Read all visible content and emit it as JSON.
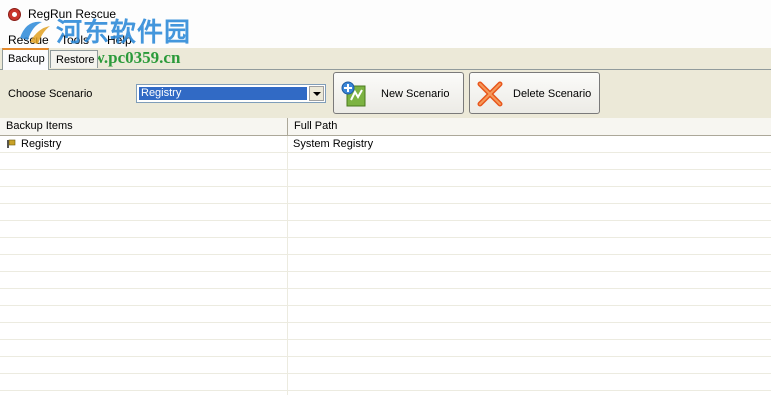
{
  "window": {
    "title": "RegRun Rescue"
  },
  "menu": [
    "Rescue",
    "Tools",
    "Help"
  ],
  "watermark": {
    "text": "河东软件园",
    "url": "www.pc0359.cn"
  },
  "tabs": [
    {
      "label": "Backup",
      "active": true
    },
    {
      "label": "Restore",
      "active": false
    }
  ],
  "toolbar": {
    "choose_label": "Choose Scenario",
    "scenario_selected": "Registry",
    "new_button": "New Scenario",
    "delete_button": "Delete Scenario"
  },
  "table": {
    "columns": [
      "Backup Items",
      "Full Path"
    ],
    "rows": [
      {
        "item": "Registry",
        "path": "System Registry"
      }
    ]
  },
  "colors": {
    "selection": "#316ac5",
    "tab_accent": "#e68b2c",
    "panel": "#ece9d8"
  }
}
